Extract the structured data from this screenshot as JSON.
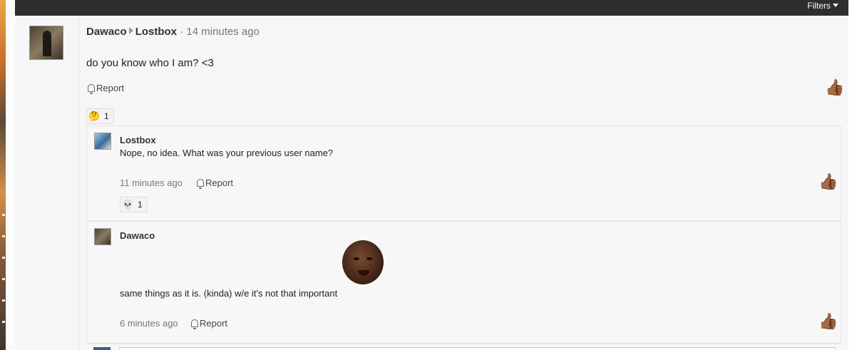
{
  "topbar": {
    "filters_label": "Filters"
  },
  "post": {
    "author": "Dawaco",
    "recipient": "Lostbox",
    "separator": "·",
    "time": "14 minutes ago",
    "body": "do you know who I am? <3",
    "report_label": "Report",
    "reaction": {
      "emoji": "🤔",
      "count": "1"
    }
  },
  "replies": [
    {
      "author": "Lostbox",
      "body": "Nope, no idea. What was your previous user name?",
      "time": "11 minutes ago",
      "report_label": "Report",
      "reaction": {
        "emoji": "💀",
        "count": "1"
      }
    },
    {
      "author": "Dawaco",
      "body": "same things as it is. (kinda) w/e it's not that important",
      "time": "6 minutes ago",
      "report_label": "Report"
    }
  ],
  "icons": {
    "thumb": "thumbs-up-icon",
    "bell": "bell-icon",
    "caret": "caret-down-icon"
  },
  "colors": {
    "topbar": "#2e2e2e",
    "page_bg": "#f6f6f8",
    "reply_bg": "#f7f7f7"
  }
}
